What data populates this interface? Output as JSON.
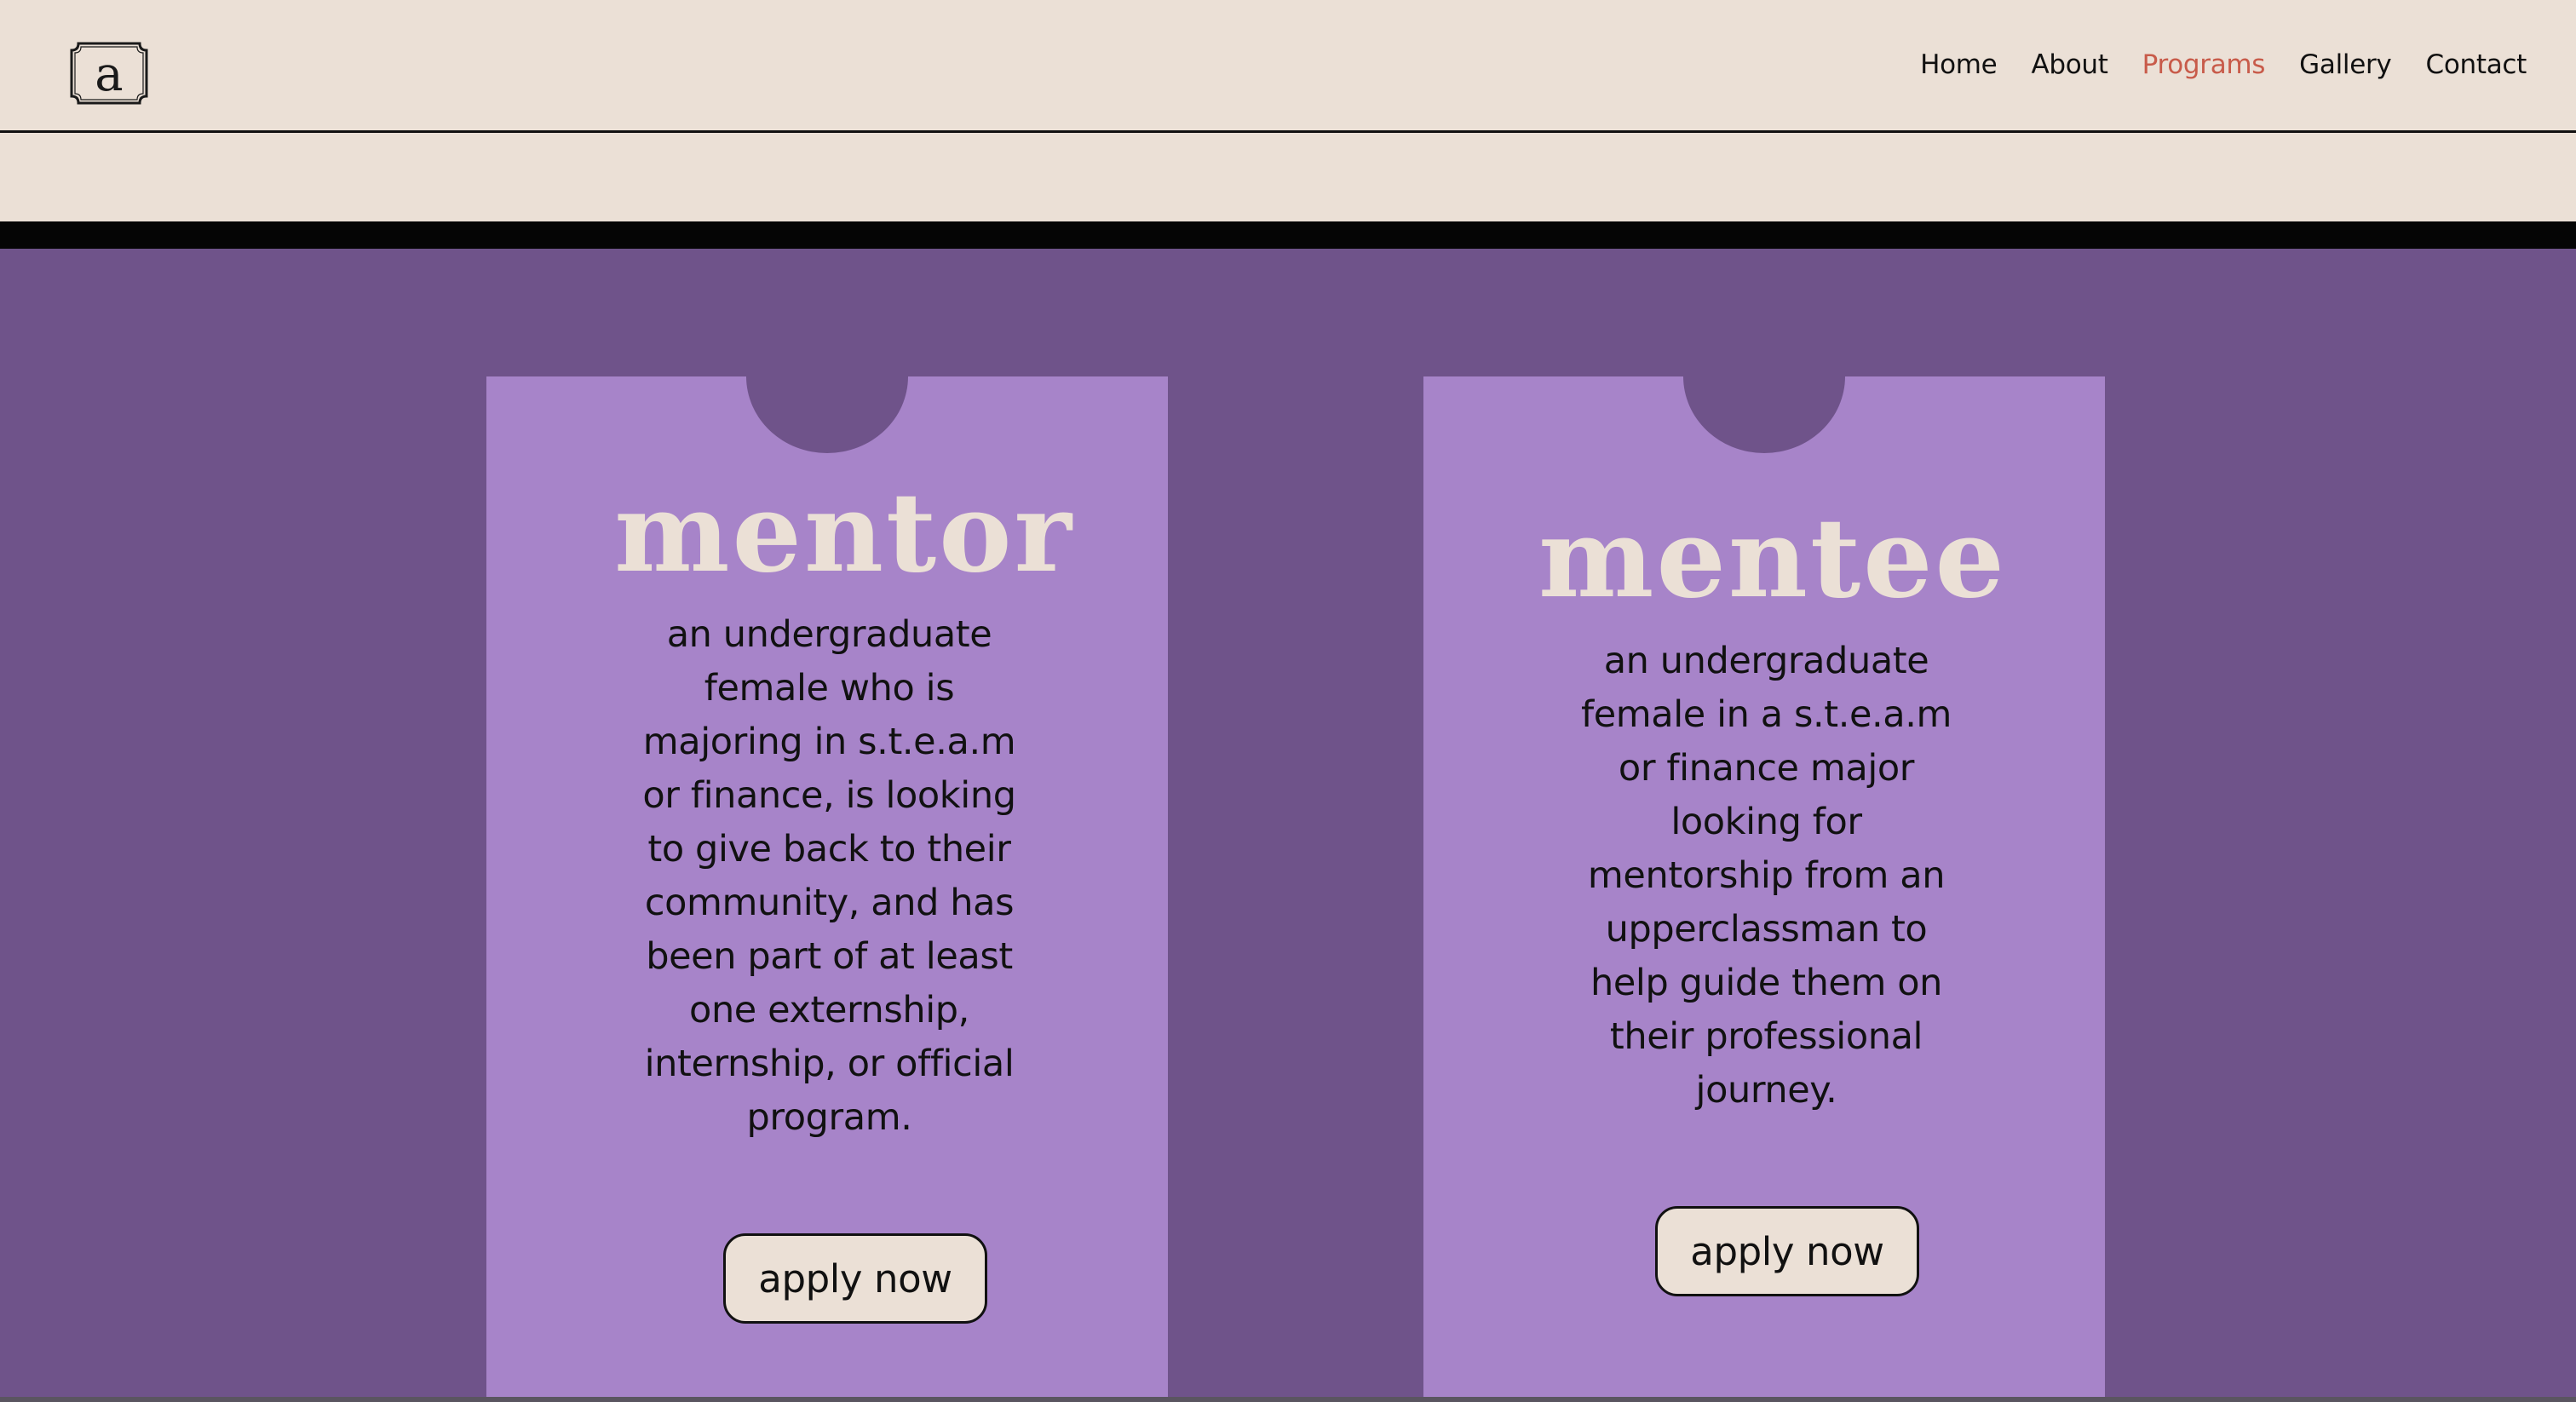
{
  "logo": {
    "letter": "a",
    "icon": "a-monogram-logo"
  },
  "nav": {
    "items": [
      {
        "label": "Home",
        "active": false
      },
      {
        "label": "About",
        "active": false
      },
      {
        "label": "Programs",
        "active": true
      },
      {
        "label": "Gallery",
        "active": false
      },
      {
        "label": "Contact",
        "active": false
      }
    ]
  },
  "colors": {
    "header_bg": "#ebe0d6",
    "section_bg": "#6f538a",
    "card_bg": "#a784c9",
    "accent_active_nav": "#c85b4a",
    "button_bg": "#ebe0d6"
  },
  "cards": [
    {
      "title": "mentor",
      "description": "an undergraduate female who is majoring in s.t.e.a.m or finance, is looking to give back to their community, and has been part of at least one externship, internship, or official program.",
      "button_label": "apply now"
    },
    {
      "title": "mentee",
      "description": "an undergraduate female in a s.t.e.a.m or finance major looking for mentorship from an upperclassman to help guide them on their professional journey.",
      "button_label": "apply now"
    }
  ]
}
